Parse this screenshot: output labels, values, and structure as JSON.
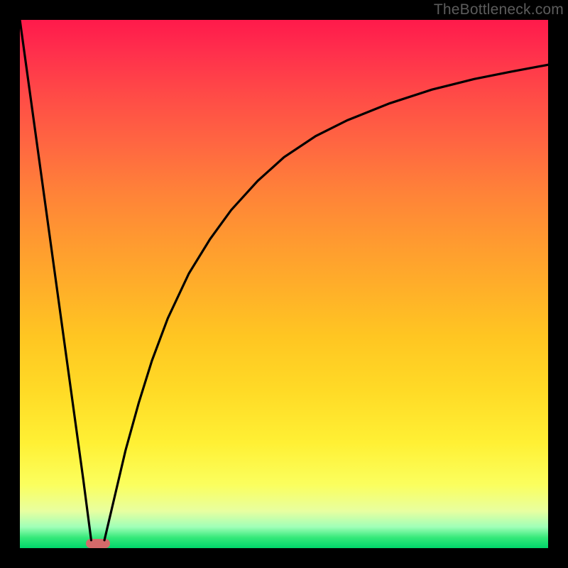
{
  "watermark": "TheBottleneck.com",
  "chart_data": {
    "type": "line",
    "title": "",
    "xlabel": "",
    "ylabel": "",
    "xlim": [
      0,
      1
    ],
    "ylim": [
      0,
      1
    ],
    "gradient_scale_note": "y=0 green (no bottleneck), y=1 red (severe bottleneck)",
    "series": [
      {
        "name": "left-branch",
        "x": [
          0.0,
          0.02,
          0.04,
          0.06,
          0.08,
          0.1,
          0.12,
          0.135
        ],
        "values": [
          1.0,
          0.855,
          0.71,
          0.565,
          0.42,
          0.275,
          0.13,
          0.015
        ]
      },
      {
        "name": "right-branch",
        "x": [
          0.16,
          0.18,
          0.2,
          0.225,
          0.25,
          0.28,
          0.32,
          0.36,
          0.4,
          0.45,
          0.5,
          0.56,
          0.62,
          0.7,
          0.78,
          0.86,
          0.93,
          1.0
        ],
        "values": [
          0.015,
          0.1,
          0.185,
          0.275,
          0.355,
          0.435,
          0.52,
          0.585,
          0.64,
          0.695,
          0.74,
          0.78,
          0.81,
          0.842,
          0.868,
          0.888,
          0.902,
          0.915
        ]
      }
    ],
    "optimal_marker": {
      "x": 0.148,
      "y": 0.0
    },
    "gradient_stops": [
      {
        "pos": 0.0,
        "color": "#ff1a4b"
      },
      {
        "pos": 0.14,
        "color": "#ff4a47"
      },
      {
        "pos": 0.33,
        "color": "#ff8338"
      },
      {
        "pos": 0.52,
        "color": "#ffb228"
      },
      {
        "pos": 0.7,
        "color": "#ffda26"
      },
      {
        "pos": 0.88,
        "color": "#fbff5e"
      },
      {
        "pos": 0.96,
        "color": "#9fffb8"
      },
      {
        "pos": 1.0,
        "color": "#00d66a"
      }
    ]
  }
}
